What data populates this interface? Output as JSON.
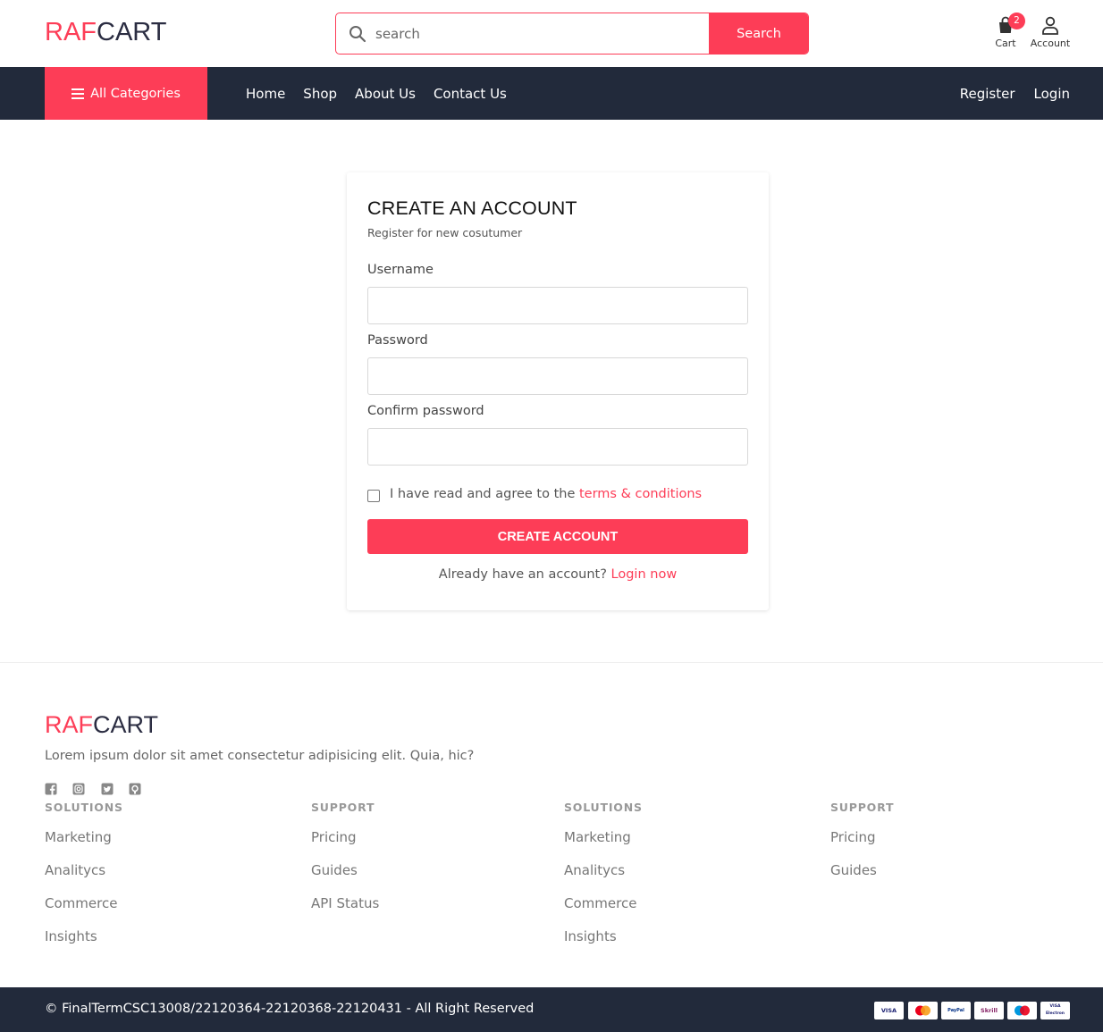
{
  "header": {
    "logo_a": "RAF",
    "logo_b": "CART",
    "search_placeholder": "search",
    "search_button": "Search",
    "cart_label": "Cart",
    "cart_count": "2",
    "account_label": "Account"
  },
  "nav": {
    "all_categories": "All Categories",
    "links": [
      "Home",
      "Shop",
      "About Us",
      "Contact Us"
    ],
    "register": "Register",
    "login": "Login"
  },
  "form": {
    "title": "CREATE AN ACCOUNT",
    "subtitle": "Register for new cosutumer",
    "username_label": "Username",
    "password_label": "Password",
    "confirm_label": "Confirm password",
    "agree_text": "I have read and agree to the",
    "terms_link": "terms & conditions",
    "submit": "CREATE ACCOUNT",
    "already_text": "Already have an account?",
    "login_link": "Login now"
  },
  "footer": {
    "logo_a": "RAF",
    "logo_b": "CART",
    "description": "Lorem ipsum dolor sit amet consectetur adipisicing elit. Quia, hic?",
    "social_icons": [
      "facebook-icon",
      "instagram-icon",
      "twitter-icon",
      "github-icon"
    ],
    "columns": [
      {
        "title": "SOLUTIONS",
        "items": [
          "Marketing",
          "Analitycs",
          "Commerce",
          "Insights"
        ]
      },
      {
        "title": "SUPPORT",
        "items": [
          "Pricing",
          "Guides",
          "API Status"
        ]
      },
      {
        "title": "SOLUTIONS",
        "items": [
          "Marketing",
          "Analitycs",
          "Commerce",
          "Insights"
        ]
      },
      {
        "title": "SUPPORT",
        "items": [
          "Pricing",
          "Guides"
        ]
      }
    ],
    "copyright": "© FinalTermCSC13008/22120364-22120368-22120431 - All Right Reserved",
    "payments": [
      "VISA",
      "mastercard",
      "PayPal",
      "Skrill",
      "maestro",
      "VISA Electron"
    ]
  },
  "colors": {
    "accent": "#fd3d57",
    "dark": "#222a3b"
  }
}
